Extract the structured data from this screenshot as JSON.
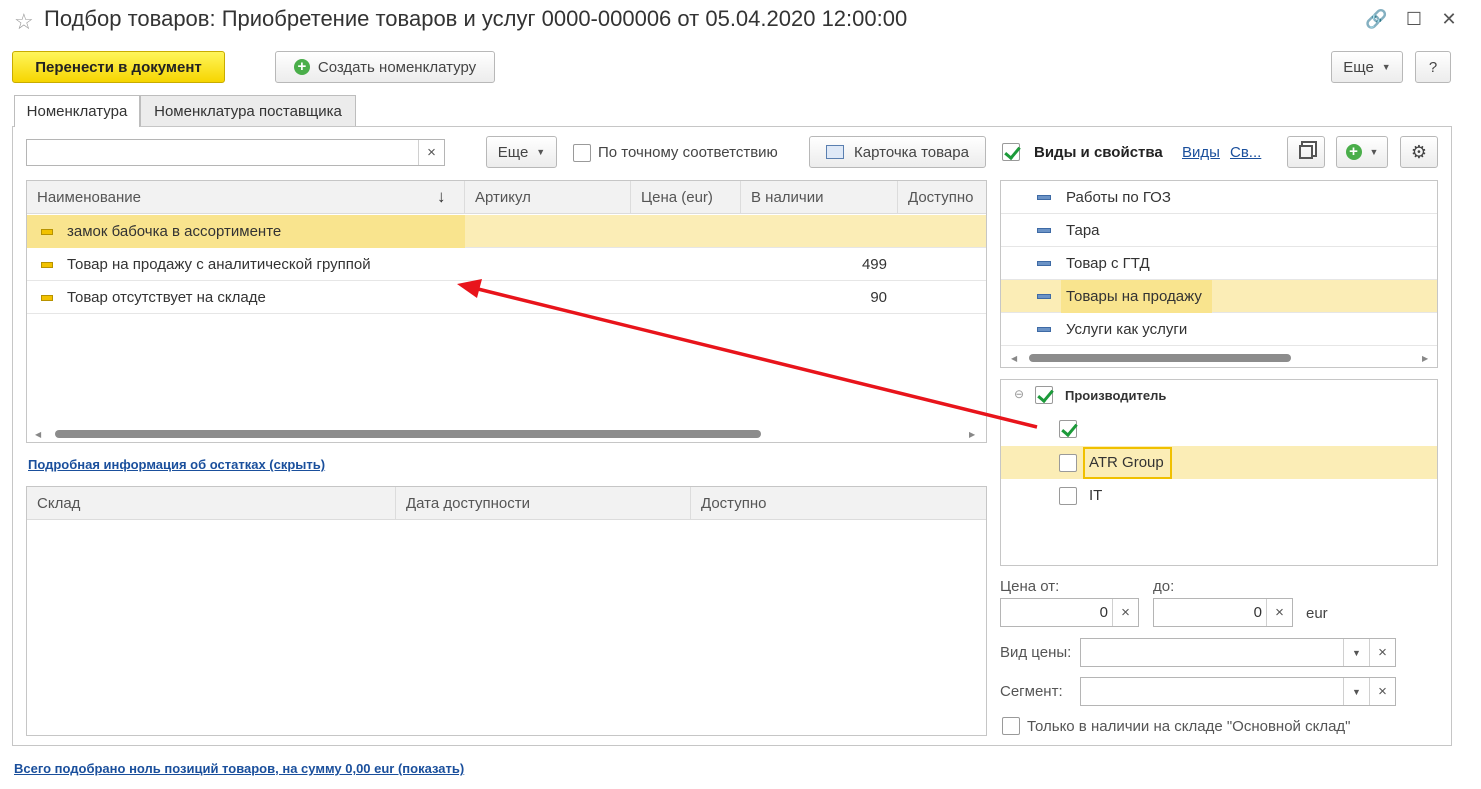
{
  "window": {
    "title": "Подбор товаров: Приобретение товаров и услуг 0000-000006 от 05.04.2020 12:00:00"
  },
  "toolbar": {
    "transfer_label": "Перенести в документ",
    "create_label": "Создать номенклатуру",
    "more_label": "Еще",
    "help_label": "?"
  },
  "tabs": [
    {
      "label": "Номенклатура",
      "active": true
    },
    {
      "label": "Номенклатура поставщика",
      "active": false
    }
  ],
  "search": {
    "value": "",
    "more_label": "Еще",
    "exact_match_label": "По точному соответствию",
    "card_label": "Карточка товара"
  },
  "products_table": {
    "columns": [
      "Наименование",
      "Артикул",
      "Цена (eur)",
      "В наличии",
      "Доступно"
    ],
    "rows": [
      {
        "name": "замок бабочка в ассортименте",
        "article": "",
        "price": "",
        "in_stock": "",
        "available": "",
        "selected": true
      },
      {
        "name": "Товар на продажу с аналитической группой",
        "article": "",
        "price": "",
        "in_stock": "499",
        "available": ""
      },
      {
        "name": "Товар отсутствует на складе",
        "article": "",
        "price": "",
        "in_stock": "90",
        "available": ""
      }
    ]
  },
  "stock_info_link": "Подробная информация об остатках (скрыть)",
  "stock_table": {
    "columns": [
      "Склад",
      "Дата доступности",
      "Доступно"
    ]
  },
  "filters": {
    "title": "Виды и свойства",
    "link_kinds": "Виды",
    "link_props": "Св...",
    "kinds": [
      {
        "label": "Работы по ГОЗ"
      },
      {
        "label": "Тара"
      },
      {
        "label": "Товар с ГТД"
      },
      {
        "label": "Товары на продажу",
        "selected": true
      },
      {
        "label": "Услуги как услуги"
      }
    ],
    "property": {
      "title": "Производитель",
      "values": [
        {
          "label": "",
          "checked": true
        },
        {
          "label": "ATR Group",
          "checked": false,
          "selected": true
        },
        {
          "label": "IT",
          "checked": false
        }
      ]
    }
  },
  "price": {
    "from_label": "Цена от:",
    "to_label": "до:",
    "from_value": "0",
    "to_value": "0",
    "currency": "eur"
  },
  "price_type": {
    "label": "Вид цены:",
    "value": ""
  },
  "segment": {
    "label": "Сегмент:",
    "value": ""
  },
  "only_in_stock_label": "Только в наличии на складе \"Основной склад\"",
  "footer_link": "Всего подобрано ноль позиций товаров, на сумму 0,00 eur (показать)",
  "colors": {
    "accent_yellow": "#f6d500",
    "selection": "#fbedb6",
    "link": "#1a4f9c",
    "check_green": "#1c9a3a",
    "arrow_red": "#e8141b"
  }
}
